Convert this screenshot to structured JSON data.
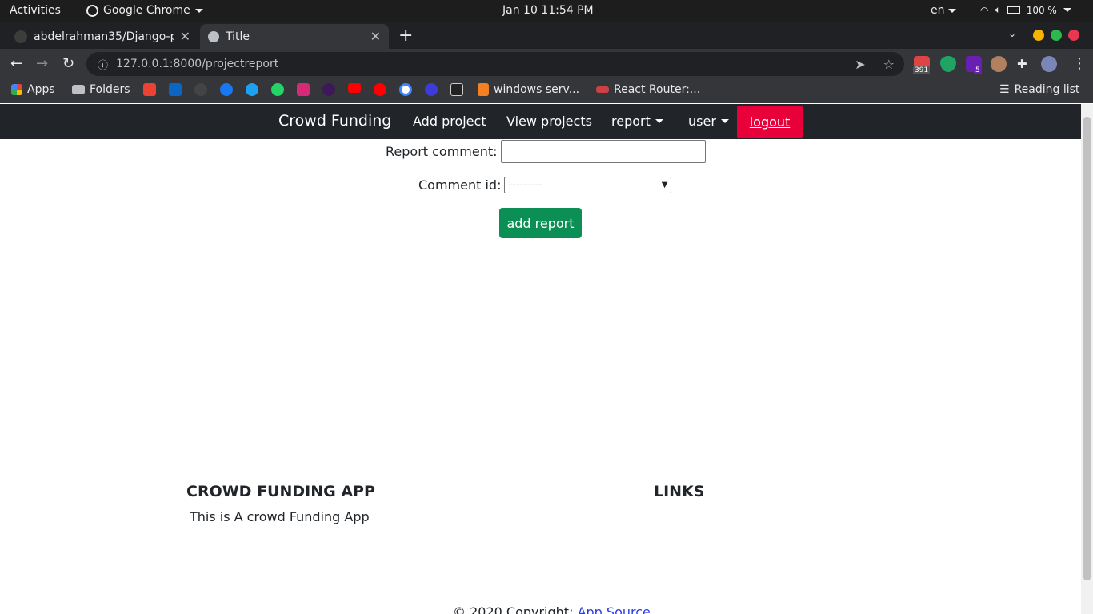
{
  "system_bar": {
    "activities": "Activities",
    "app_name": "Google Chrome",
    "clock": "Jan 10  11:54 PM",
    "language": "en",
    "battery": "100 %"
  },
  "tabs": [
    {
      "title": "abdelrahman35/Django-p",
      "active": false
    },
    {
      "title": "Title",
      "active": true
    }
  ],
  "toolbar": {
    "url": "127.0.0.1:8000/projectreport",
    "extensions_badge_mail": "391",
    "extensions_badge_count": "5"
  },
  "bookmarks": {
    "apps": "Apps",
    "folders": "Folders",
    "windows": "windows serv...",
    "react": "React Router:...",
    "reading_list": "Reading list"
  },
  "navbar": {
    "brand": "Crowd Funding",
    "add_project": "Add project",
    "view_projects": "View projects",
    "report": "report",
    "user": "user",
    "logout": "logout"
  },
  "form": {
    "report_comment_label": "Report comment:",
    "report_comment_value": "",
    "comment_id_label": "Comment id:",
    "comment_id_selected": "---------",
    "submit": "add report"
  },
  "footer": {
    "app_heading": "CROWD FUNDING APP",
    "app_desc": "This is A crowd Funding App",
    "links_heading": "LINKS",
    "copyright": "© 2020 Copyright:",
    "copyright_link": "App Source"
  },
  "colors": {
    "navbar_bg": "#212529",
    "logout_bg": "#e8003b",
    "submit_bg": "#0b8f55"
  }
}
